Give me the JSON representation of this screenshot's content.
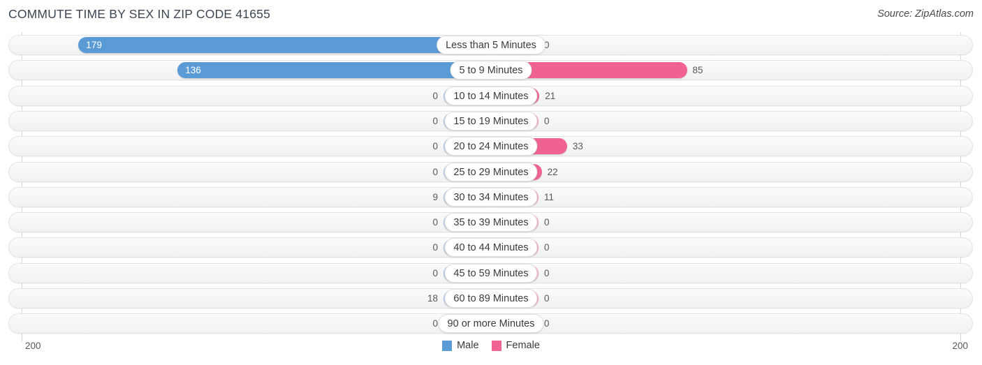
{
  "header": {
    "title": "COMMUTE TIME BY SEX IN ZIP CODE 41655",
    "source": "Source: ZipAtlas.com"
  },
  "axis": {
    "left_label": "200",
    "right_label": "200",
    "max": 200
  },
  "legend": {
    "items": [
      {
        "label": "Male",
        "color": "#5b9bd5"
      },
      {
        "label": "Female",
        "color": "#f0628f"
      }
    ]
  },
  "colors": {
    "male_strong": "#5b9bd5",
    "male_light": "#aecbeb",
    "female_strong": "#f0628f",
    "female_light": "#f9a8c4",
    "track": "#f6f6f6",
    "title": "#3c4652"
  },
  "chart_data": {
    "type": "bar",
    "subtype": "diverging-bidirectional",
    "title": "COMMUTE TIME BY SEX IN ZIP CODE 41655",
    "xlabel": "",
    "ylabel": "",
    "xlim": [
      200,
      200
    ],
    "grid": true,
    "legend_position": "bottom-center",
    "categories": [
      "Less than 5 Minutes",
      "5 to 9 Minutes",
      "10 to 14 Minutes",
      "15 to 19 Minutes",
      "20 to 24 Minutes",
      "25 to 29 Minutes",
      "30 to 34 Minutes",
      "35 to 39 Minutes",
      "40 to 44 Minutes",
      "45 to 59 Minutes",
      "60 to 89 Minutes",
      "90 or more Minutes"
    ],
    "series": [
      {
        "name": "Male",
        "direction": "left",
        "values": [
          179,
          136,
          0,
          0,
          0,
          0,
          9,
          0,
          0,
          0,
          18,
          0
        ]
      },
      {
        "name": "Female",
        "direction": "right",
        "values": [
          0,
          85,
          21,
          0,
          33,
          22,
          11,
          0,
          0,
          0,
          0,
          0
        ]
      }
    ]
  },
  "rows": [
    {
      "category": "Less than 5 Minutes",
      "male": 179,
      "female": 0,
      "male_text": "179",
      "female_text": "0"
    },
    {
      "category": "5 to 9 Minutes",
      "male": 136,
      "female": 85,
      "male_text": "136",
      "female_text": "85"
    },
    {
      "category": "10 to 14 Minutes",
      "male": 0,
      "female": 21,
      "male_text": "0",
      "female_text": "21"
    },
    {
      "category": "15 to 19 Minutes",
      "male": 0,
      "female": 0,
      "male_text": "0",
      "female_text": "0"
    },
    {
      "category": "20 to 24 Minutes",
      "male": 0,
      "female": 33,
      "male_text": "0",
      "female_text": "33"
    },
    {
      "category": "25 to 29 Minutes",
      "male": 0,
      "female": 22,
      "male_text": "0",
      "female_text": "22"
    },
    {
      "category": "30 to 34 Minutes",
      "male": 9,
      "female": 11,
      "male_text": "9",
      "female_text": "11"
    },
    {
      "category": "35 to 39 Minutes",
      "male": 0,
      "female": 0,
      "male_text": "0",
      "female_text": "0"
    },
    {
      "category": "40 to 44 Minutes",
      "male": 0,
      "female": 0,
      "male_text": "0",
      "female_text": "0"
    },
    {
      "category": "45 to 59 Minutes",
      "male": 0,
      "female": 0,
      "male_text": "0",
      "female_text": "0"
    },
    {
      "category": "60 to 89 Minutes",
      "male": 18,
      "female": 0,
      "male_text": "18",
      "female_text": "0"
    },
    {
      "category": "90 or more Minutes",
      "male": 0,
      "female": 0,
      "male_text": "0",
      "female_text": "0"
    }
  ]
}
